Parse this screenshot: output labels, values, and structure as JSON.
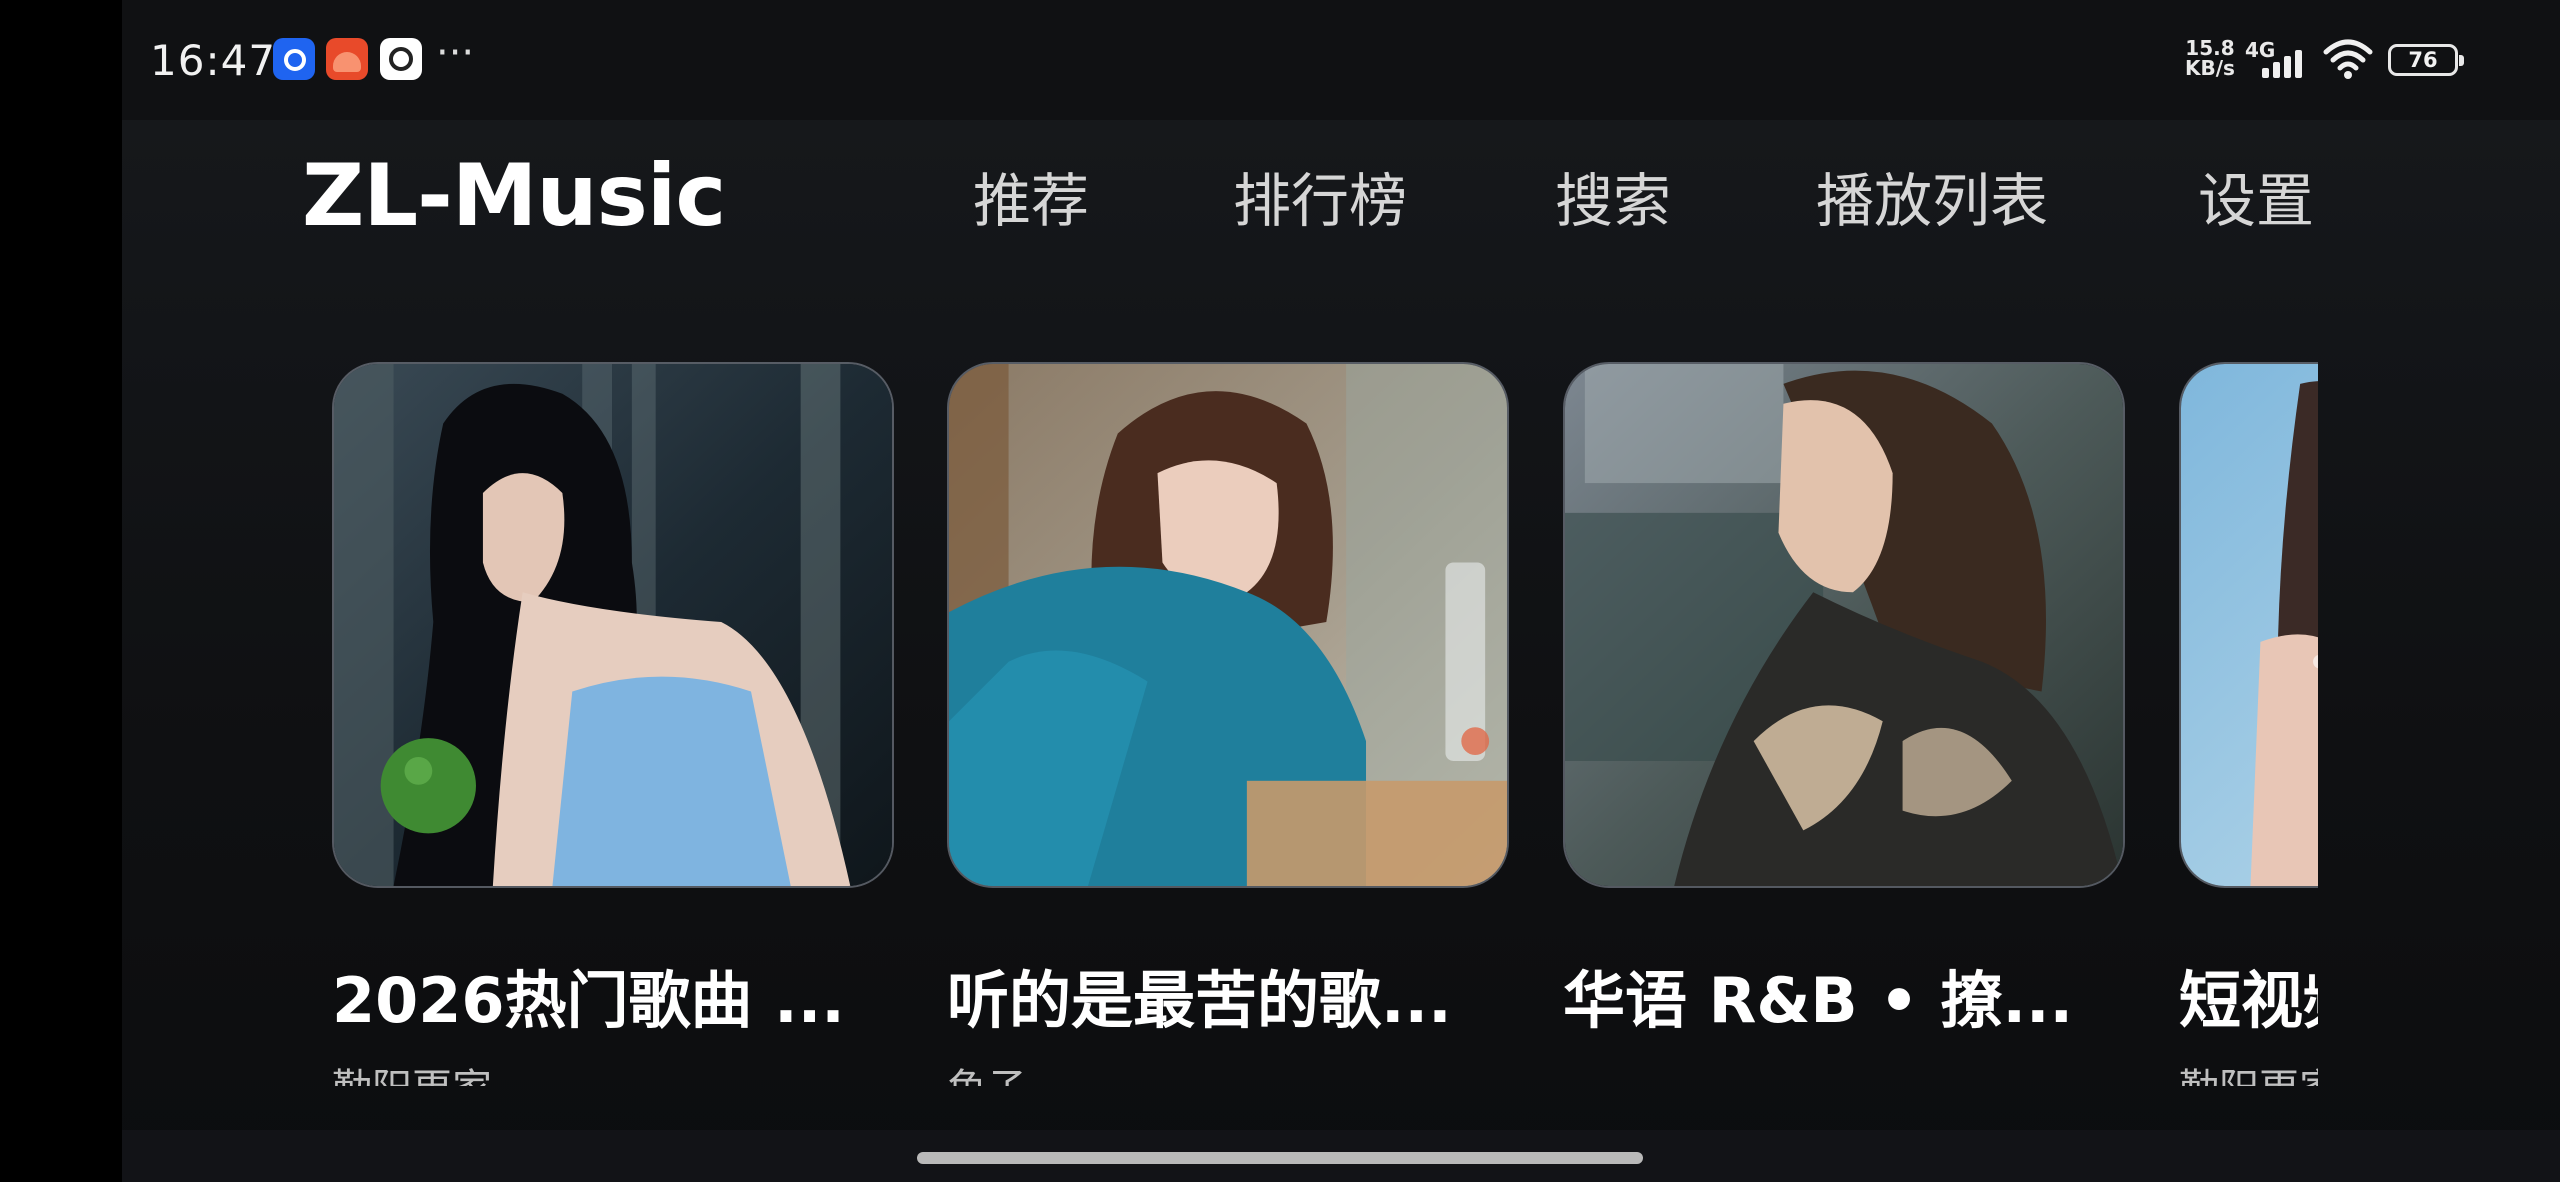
{
  "status_bar": {
    "time": "16:47",
    "more": "···",
    "net_speed_top": "15.8",
    "net_speed_bottom": "KB/s",
    "net_type": "4G",
    "battery": "76"
  },
  "header": {
    "logo": "ZL-Music",
    "nav": [
      "推荐",
      "排行榜",
      "搜索",
      "播放列表",
      "设置"
    ]
  },
  "playlists": [
    {
      "title": "2026热门歌曲 ...",
      "subtitle": "勤阳更家"
    },
    {
      "title": "听的是最苦的歌...",
      "subtitle": "鱼子"
    },
    {
      "title": "华语 R&B • 撩...",
      "subtitle": ""
    },
    {
      "title": "短视频热歌",
      "subtitle": "勤阳更家"
    }
  ],
  "colors": {
    "background": "#0f1012",
    "status_bar": "#101113",
    "text": "#ffffff",
    "nav_text": "#d6d6d6"
  }
}
